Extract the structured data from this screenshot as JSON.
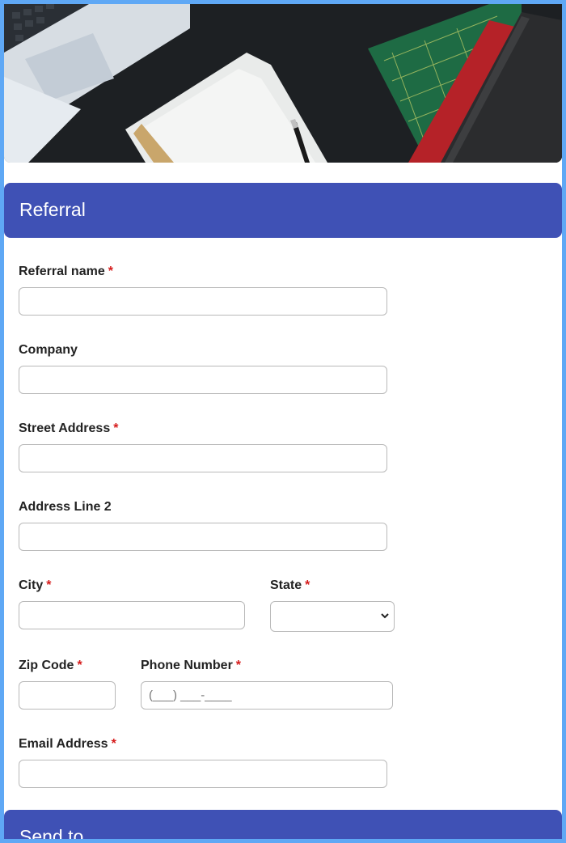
{
  "sections": {
    "referral_title": "Referral",
    "send_to_title": "Send to"
  },
  "fields": {
    "referral_name": {
      "label": "Referral name",
      "required": "*",
      "value": ""
    },
    "company": {
      "label": "Company",
      "value": ""
    },
    "street_address": {
      "label": "Street Address",
      "required": "*",
      "value": ""
    },
    "address_line_2": {
      "label": "Address Line 2",
      "value": ""
    },
    "city": {
      "label": "City",
      "required": "*",
      "value": ""
    },
    "state": {
      "label": "State",
      "required": "*",
      "selected": ""
    },
    "zip_code": {
      "label": "Zip Code",
      "required": "*",
      "value": ""
    },
    "phone_number": {
      "label": "Phone Number",
      "required": "*",
      "placeholder": "(___) ___-____"
    },
    "email_address": {
      "label": "Email Address",
      "required": "*",
      "value": ""
    }
  },
  "icons": {
    "state_dropdown": "chevron-down-icon"
  },
  "colors": {
    "header_bg": "#3f51b5",
    "page_border": "#5fa8f5",
    "required_mark": "#d61b1b"
  }
}
